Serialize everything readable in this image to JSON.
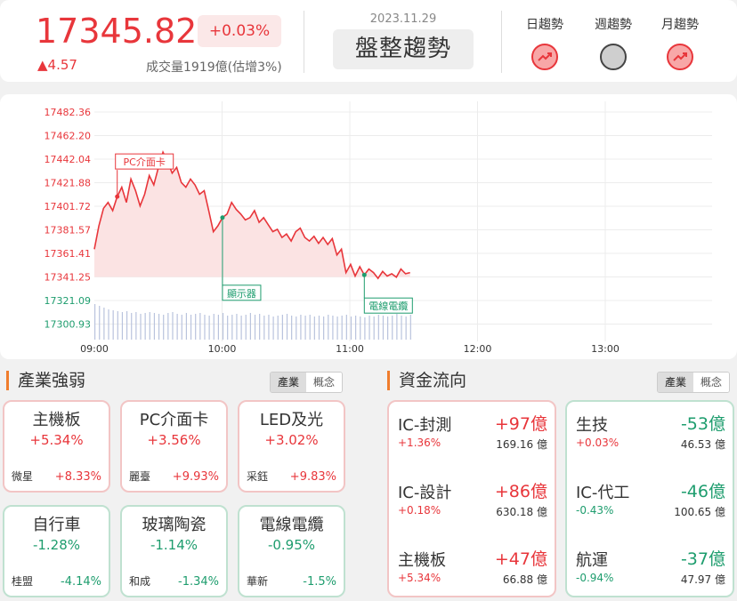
{
  "header": {
    "price": "17345.82",
    "change_pct": "+0.03%",
    "change_pts": "▲4.57",
    "volume": "成交量1919億(估增3%)",
    "date": "2023.11.29",
    "trend": "盤整趨勢",
    "trend_labels": [
      {
        "label": "日趨勢",
        "state": "up-icon"
      },
      {
        "label": "週趨勢",
        "state": "flat-icon"
      },
      {
        "label": "月趨勢",
        "state": "up-icon"
      }
    ]
  },
  "chart_data": {
    "type": "line",
    "y_ticks": [
      "17482.36",
      "17462.20",
      "17442.04",
      "17421.88",
      "17401.72",
      "17381.57",
      "17361.41",
      "17341.25",
      "17321.09",
      "17300.93"
    ],
    "ylim": [
      17300.93,
      17482.36
    ],
    "reference": 17341.25,
    "x_ticks": [
      "09:00",
      "10:00",
      "11:00",
      "12:00",
      "13:00"
    ],
    "x_start_min": 0,
    "x_end_min": 270,
    "series": [
      {
        "x": [
          0,
          2,
          4,
          6,
          8,
          10,
          12,
          14,
          16,
          18,
          20,
          22,
          24,
          26,
          28,
          30,
          32,
          34,
          36,
          38,
          40,
          42,
          44,
          46,
          48,
          50,
          52,
          54,
          56,
          58,
          60,
          62,
          64,
          66,
          68,
          70,
          72,
          74,
          76,
          78,
          80,
          82,
          84,
          86,
          88,
          90,
          92,
          94,
          96,
          98,
          100,
          102,
          104,
          106,
          108,
          110,
          112,
          114,
          116,
          118,
          120,
          122,
          124,
          126,
          128,
          130,
          132,
          134,
          136,
          138
        ],
        "values": [
          17365,
          17385,
          17400,
          17405,
          17398,
          17410,
          17418,
          17405,
          17425,
          17415,
          17402,
          17412,
          17428,
          17420,
          17435,
          17448,
          17440,
          17430,
          17435,
          17422,
          17418,
          17425,
          17420,
          17412,
          17415,
          17398,
          17380,
          17385,
          17392,
          17395,
          17405,
          17399,
          17395,
          17390,
          17392,
          17398,
          17388,
          17392,
          17386,
          17380,
          17382,
          17375,
          17378,
          17372,
          17380,
          17383,
          17375,
          17372,
          17376,
          17370,
          17375,
          17369,
          17374,
          17360,
          17365,
          17345,
          17352,
          17342,
          17350,
          17343,
          17348,
          17345,
          17340,
          17346,
          17342,
          17344,
          17341,
          17348,
          17344,
          17345
        ]
      }
    ],
    "volume": [
      40,
      38,
      36,
      34,
      33,
      32,
      31,
      32,
      30,
      31,
      29,
      30,
      31,
      30,
      29,
      28,
      30,
      31,
      29,
      28,
      30,
      28,
      29,
      30,
      28,
      27,
      29,
      28,
      30,
      27,
      28,
      29,
      27,
      28,
      30,
      28,
      29,
      27,
      28,
      26,
      27,
      28,
      29,
      27,
      26,
      28,
      27,
      28,
      26,
      27,
      26,
      28,
      27,
      26,
      27,
      28,
      26,
      27,
      26,
      25,
      27,
      26,
      28,
      27,
      26,
      27,
      29,
      27,
      26,
      28
    ],
    "annotations": [
      {
        "label": "PC介面卡",
        "at_min": 10,
        "kind": "red"
      },
      {
        "label": "顯示器",
        "at_min": 56,
        "kind": "green"
      },
      {
        "label": "電線電纜",
        "at_min": 118,
        "kind": "green"
      }
    ]
  },
  "industry": {
    "title": "產業強弱",
    "tabs": [
      "產業",
      "概念"
    ],
    "cards": [
      {
        "name": "主機板",
        "pct": "+5.34%",
        "stock": "微星",
        "stock_pct": "+8.33%",
        "tone": "r"
      },
      {
        "name": "PC介面卡",
        "pct": "+3.56%",
        "stock": "麗臺",
        "stock_pct": "+9.93%",
        "tone": "r"
      },
      {
        "name": "LED及光",
        "pct": "+3.02%",
        "stock": "采鈺",
        "stock_pct": "+9.83%",
        "tone": "r"
      },
      {
        "name": "自行車",
        "pct": "-1.28%",
        "stock": "桂盟",
        "stock_pct": "-4.14%",
        "tone": "g"
      },
      {
        "name": "玻璃陶瓷",
        "pct": "-1.14%",
        "stock": "和成",
        "stock_pct": "-1.34%",
        "tone": "g"
      },
      {
        "name": "電線電纜",
        "pct": "-0.95%",
        "stock": "華新",
        "stock_pct": "-1.5%",
        "tone": "g"
      }
    ]
  },
  "flow": {
    "title": "資金流向",
    "tabs": [
      "產業",
      "概念"
    ],
    "inflow": [
      {
        "name": "IC-封測",
        "amount": "+97億",
        "pct": "+1.36%",
        "turnover": "169.16 億"
      },
      {
        "name": "IC-設計",
        "amount": "+86億",
        "pct": "+0.18%",
        "turnover": "630.18 億"
      },
      {
        "name": "主機板",
        "amount": "+47億",
        "pct": "+5.34%",
        "turnover": "66.88 億"
      }
    ],
    "outflow": [
      {
        "name": "生技",
        "amount": "-53億",
        "pct": "+0.03%",
        "turnover": "46.53 億"
      },
      {
        "name": "IC-代工",
        "amount": "-46億",
        "pct": "-0.43%",
        "turnover": "100.65 億"
      },
      {
        "name": "航運",
        "amount": "-37億",
        "pct": "-0.94%",
        "turnover": "47.97 億"
      }
    ]
  }
}
